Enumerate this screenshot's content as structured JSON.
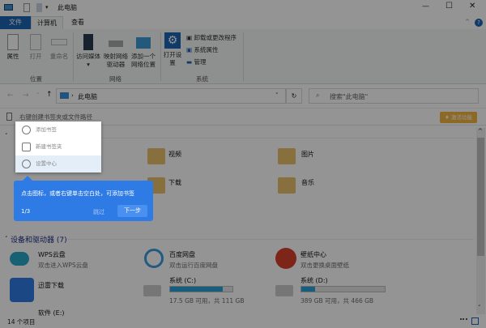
{
  "titlebar": {
    "title": "此电脑",
    "minimize": "—",
    "maximize": "☐",
    "close": "✕"
  },
  "ribbon_tabs": [
    {
      "label": "文件"
    },
    {
      "label": "计算机"
    },
    {
      "label": "查看"
    }
  ],
  "ribbon": {
    "location": {
      "group": "位置",
      "items": [
        "属性",
        "打开",
        "重命名"
      ]
    },
    "network": {
      "group": "网络",
      "items": [
        "访问媒体",
        "映射网络驱动器",
        "添加一个网络位置"
      ]
    },
    "system": {
      "group": "系统",
      "open": "打开设置",
      "items": [
        "卸载或更改程序",
        "系统属性",
        "管理"
      ]
    }
  },
  "nav": {
    "address": "此电脑",
    "search_placeholder": "搜索\"此电脑\""
  },
  "bookmark_bar": {
    "hint": "右键创建书签夹或文件路径",
    "activate": "激活功能"
  },
  "folders": [
    {
      "name": "视频"
    },
    {
      "name": "图片"
    },
    {
      "name": "下载"
    },
    {
      "name": "音乐"
    }
  ],
  "devices_header": "设备和驱动器 (7)",
  "devices": [
    {
      "name": "WPS云盘",
      "desc": "双击进入WPS云盘"
    },
    {
      "name": "百度网盘",
      "desc": "双击运行百度网盘"
    },
    {
      "name": "壁纸中心",
      "desc": "双击更换桌面壁纸"
    },
    {
      "name": "迅雷下载"
    }
  ],
  "drives": [
    {
      "name": "系统 (C:)",
      "info": "17.5 GB 可用，共 111 GB",
      "used_fraction": 0.84
    },
    {
      "name": "系统 (D:)",
      "info": "389 GB 可用，共 466 GB",
      "used_fraction": 0.165
    },
    {
      "name": "软件 (E:)"
    }
  ],
  "status": {
    "count": "14 个项目"
  },
  "popup_menu": [
    {
      "label": "添加书签"
    },
    {
      "label": "新建书签夹"
    },
    {
      "label": "设置中心"
    }
  ],
  "tooltip": {
    "text": "点击图标，或者右键单击空白处，可添加书签",
    "step": "1/3",
    "skip": "跳过",
    "next": "下一步"
  }
}
